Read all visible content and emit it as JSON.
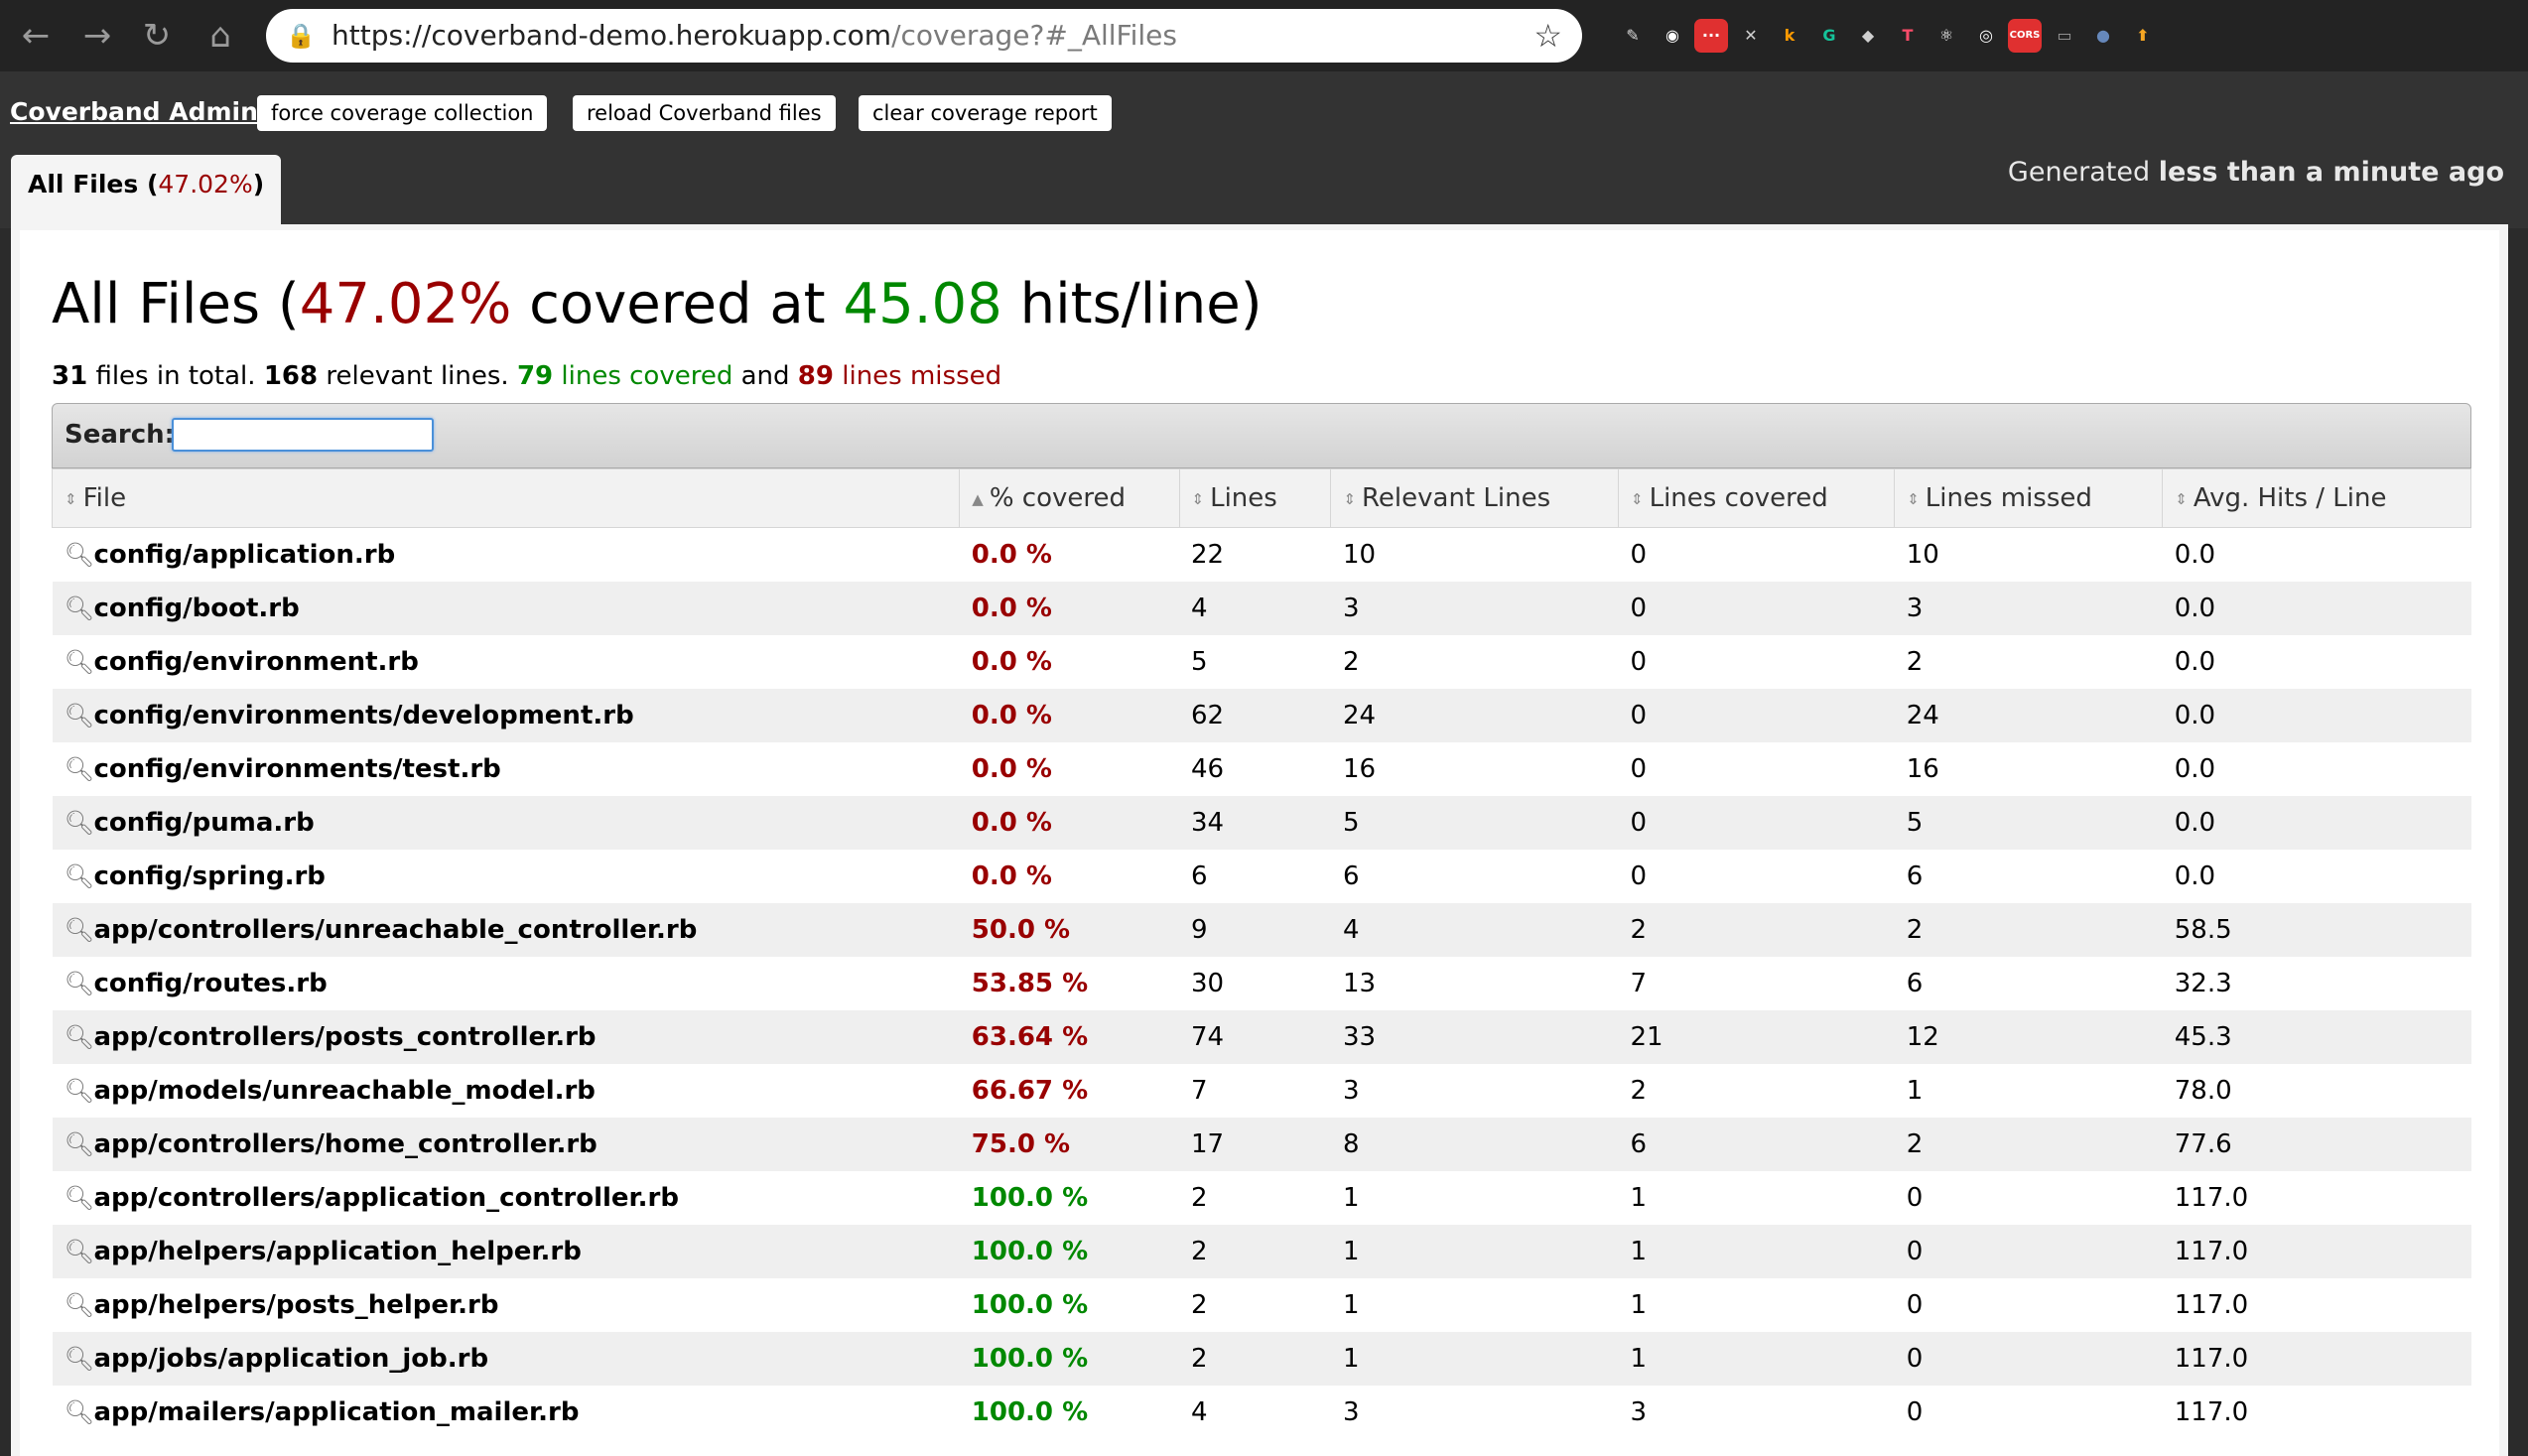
{
  "browser": {
    "url_host": "https://coverband-demo.herokuapp.com",
    "url_path": "/coverage?#_AllFiles",
    "nav_icons": [
      "back-arrow-icon",
      "forward-arrow-icon",
      "reload-icon",
      "home-icon"
    ],
    "extensions": [
      {
        "name": "extension-icon-1",
        "glyph": "✎",
        "color": "#d8d8d8"
      },
      {
        "name": "extension-icon-2",
        "glyph": "◉",
        "color": "#ffffff"
      },
      {
        "name": "extension-icon-3",
        "glyph": "···",
        "color": "#e03030"
      },
      {
        "name": "extension-icon-4",
        "glyph": "✕",
        "color": "#cfcfcf"
      },
      {
        "name": "extension-icon-5",
        "glyph": "k",
        "color": "#ff9a00"
      },
      {
        "name": "extension-icon-6",
        "glyph": "G",
        "color": "#15c39a"
      },
      {
        "name": "extension-icon-7",
        "glyph": "◆",
        "color": "#cfcfcf"
      },
      {
        "name": "extension-icon-8",
        "glyph": "T",
        "color": "#ff4c6a"
      },
      {
        "name": "extension-icon-9",
        "glyph": "⚛",
        "color": "#ffffff"
      },
      {
        "name": "extension-icon-10",
        "glyph": "◎",
        "color": "#ffffff"
      },
      {
        "name": "extension-icon-11",
        "glyph": "CORS",
        "color": "#e03030"
      },
      {
        "name": "extension-icon-12",
        "glyph": "▭",
        "color": "#9c9c9c"
      },
      {
        "name": "extension-icon-13",
        "glyph": "●",
        "color": "#6688bb"
      },
      {
        "name": "extension-icon-14",
        "glyph": "⬆",
        "color": "#f5a623"
      }
    ]
  },
  "header": {
    "brand": "Coverband Admin",
    "buttons": [
      "force coverage collection",
      "reload Coverband files",
      "clear coverage report"
    ],
    "generated_prefix": "Generated",
    "generated_time": "less than a minute ago"
  },
  "tab": {
    "label": "All Files",
    "percent": "47.02%"
  },
  "report": {
    "title": "All Files",
    "covered_percent": "47.02%",
    "covered_word": "covered at",
    "hits_per_line": "45.08",
    "hits_suffix": "hits/line",
    "summary": {
      "files": "31",
      "files_text": "files in total.",
      "relevant": "168",
      "relevant_text": "relevant lines.",
      "covered": "79",
      "covered_text": "lines covered",
      "and_text": "and",
      "missed": "89",
      "missed_text": "lines missed"
    },
    "search_label": "Search:",
    "search_value": ""
  },
  "table": {
    "columns": [
      "File",
      "% covered",
      "Lines",
      "Relevant Lines",
      "Lines covered",
      "Lines missed",
      "Avg. Hits / Line"
    ],
    "rows": [
      {
        "file": "config/application.rb",
        "pct": "0.0 %",
        "lines": "22",
        "relevant": "10",
        "covered": "0",
        "missed": "10",
        "avg": "0.0",
        "level": "low"
      },
      {
        "file": "config/boot.rb",
        "pct": "0.0 %",
        "lines": "4",
        "relevant": "3",
        "covered": "0",
        "missed": "3",
        "avg": "0.0",
        "level": "low"
      },
      {
        "file": "config/environment.rb",
        "pct": "0.0 %",
        "lines": "5",
        "relevant": "2",
        "covered": "0",
        "missed": "2",
        "avg": "0.0",
        "level": "low"
      },
      {
        "file": "config/environments/development.rb",
        "pct": "0.0 %",
        "lines": "62",
        "relevant": "24",
        "covered": "0",
        "missed": "24",
        "avg": "0.0",
        "level": "low"
      },
      {
        "file": "config/environments/test.rb",
        "pct": "0.0 %",
        "lines": "46",
        "relevant": "16",
        "covered": "0",
        "missed": "16",
        "avg": "0.0",
        "level": "low"
      },
      {
        "file": "config/puma.rb",
        "pct": "0.0 %",
        "lines": "34",
        "relevant": "5",
        "covered": "0",
        "missed": "5",
        "avg": "0.0",
        "level": "low"
      },
      {
        "file": "config/spring.rb",
        "pct": "0.0 %",
        "lines": "6",
        "relevant": "6",
        "covered": "0",
        "missed": "6",
        "avg": "0.0",
        "level": "low"
      },
      {
        "file": "app/controllers/unreachable_controller.rb",
        "pct": "50.0 %",
        "lines": "9",
        "relevant": "4",
        "covered": "2",
        "missed": "2",
        "avg": "58.5",
        "level": "low"
      },
      {
        "file": "config/routes.rb",
        "pct": "53.85 %",
        "lines": "30",
        "relevant": "13",
        "covered": "7",
        "missed": "6",
        "avg": "32.3",
        "level": "low"
      },
      {
        "file": "app/controllers/posts_controller.rb",
        "pct": "63.64 %",
        "lines": "74",
        "relevant": "33",
        "covered": "21",
        "missed": "12",
        "avg": "45.3",
        "level": "low"
      },
      {
        "file": "app/models/unreachable_model.rb",
        "pct": "66.67 %",
        "lines": "7",
        "relevant": "3",
        "covered": "2",
        "missed": "1",
        "avg": "78.0",
        "level": "low"
      },
      {
        "file": "app/controllers/home_controller.rb",
        "pct": "75.0 %",
        "lines": "17",
        "relevant": "8",
        "covered": "6",
        "missed": "2",
        "avg": "77.6",
        "level": "low"
      },
      {
        "file": "app/controllers/application_controller.rb",
        "pct": "100.0 %",
        "lines": "2",
        "relevant": "1",
        "covered": "1",
        "missed": "0",
        "avg": "117.0",
        "level": "high"
      },
      {
        "file": "app/helpers/application_helper.rb",
        "pct": "100.0 %",
        "lines": "2",
        "relevant": "1",
        "covered": "1",
        "missed": "0",
        "avg": "117.0",
        "level": "high"
      },
      {
        "file": "app/helpers/posts_helper.rb",
        "pct": "100.0 %",
        "lines": "2",
        "relevant": "1",
        "covered": "1",
        "missed": "0",
        "avg": "117.0",
        "level": "high"
      },
      {
        "file": "app/jobs/application_job.rb",
        "pct": "100.0 %",
        "lines": "2",
        "relevant": "1",
        "covered": "1",
        "missed": "0",
        "avg": "117.0",
        "level": "high"
      },
      {
        "file": "app/mailers/application_mailer.rb",
        "pct": "100.0 %",
        "lines": "4",
        "relevant": "3",
        "covered": "3",
        "missed": "0",
        "avg": "117.0",
        "level": "high"
      }
    ]
  },
  "colors": {
    "low": "#990000",
    "high": "#008800",
    "topbar": "#333333"
  }
}
